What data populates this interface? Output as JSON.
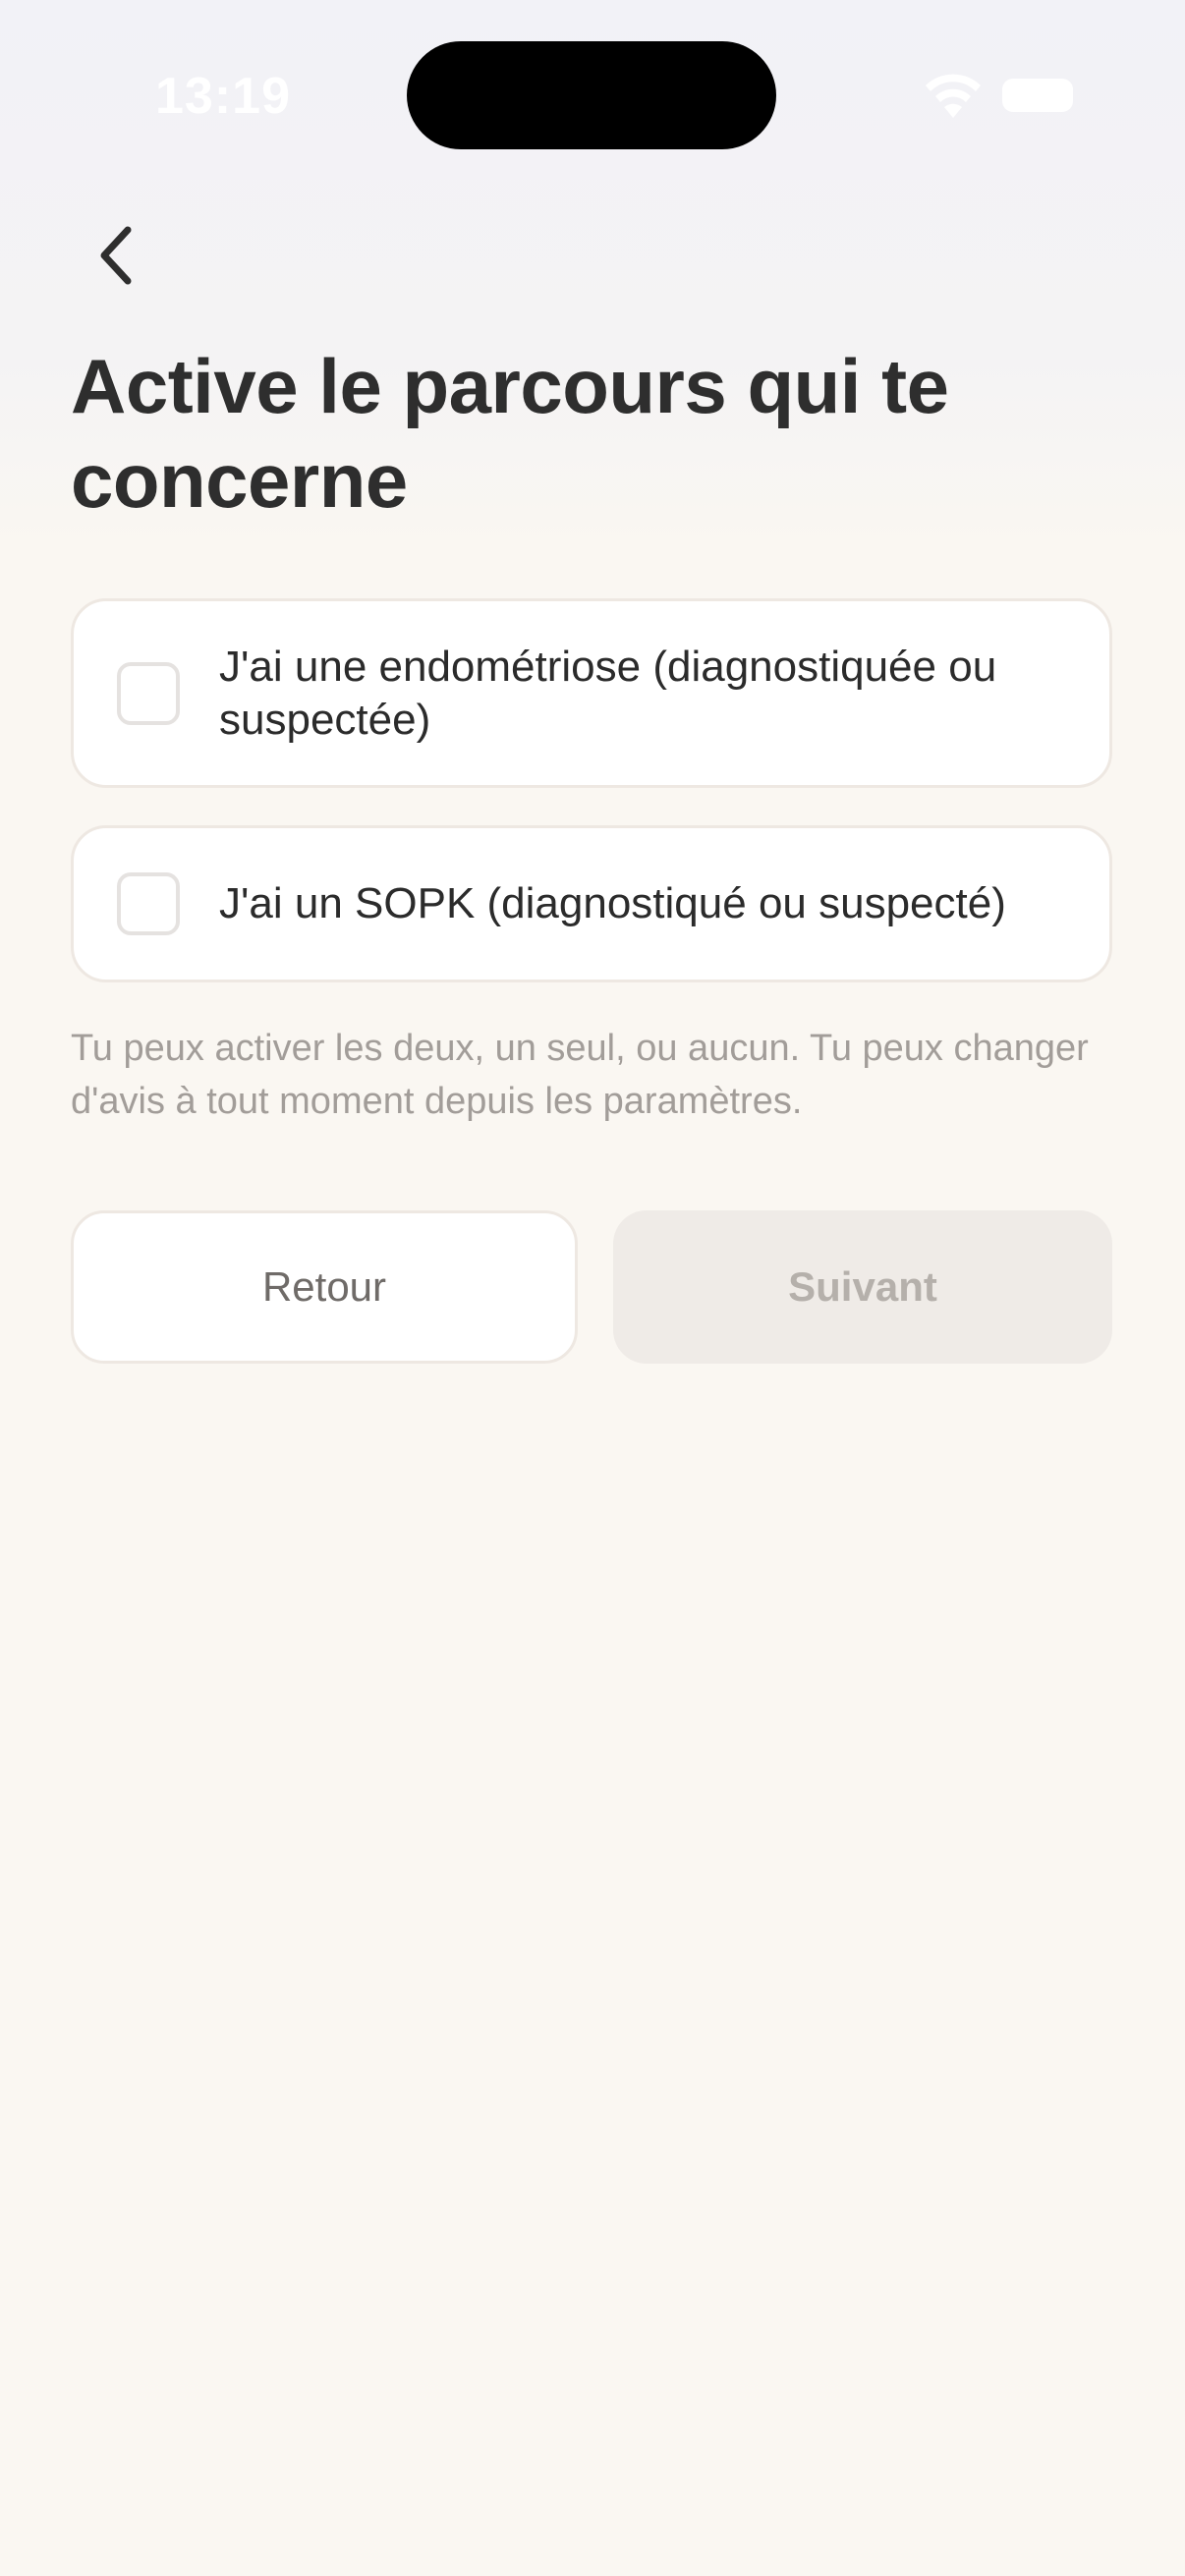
{
  "status_bar": {
    "time": "13:19"
  },
  "icons": {
    "back": "chevron-left-icon",
    "wifi": "wifi-icon",
    "battery": "battery-icon"
  },
  "header": {
    "title": "Active le parcours qui te concerne"
  },
  "options": [
    {
      "label": "J'ai une endométriose (diagnostiquée ou suspectée)",
      "checked": false
    },
    {
      "label": "J'ai un SOPK (diagnostiqué ou suspecté)",
      "checked": false
    }
  ],
  "helper_text": "Tu peux activer les deux, un seul, ou aucun. Tu peux changer d'avis à tout moment depuis les paramètres.",
  "buttons": {
    "back_label": "Retour",
    "next_label": "Suivant",
    "next_enabled": false
  },
  "colors": {
    "background": "#faf7f2",
    "title": "#2e2e2e",
    "helper": "#a29d99",
    "disabled_button_bg": "#efebe7",
    "disabled_button_text": "#b5b0ab"
  }
}
